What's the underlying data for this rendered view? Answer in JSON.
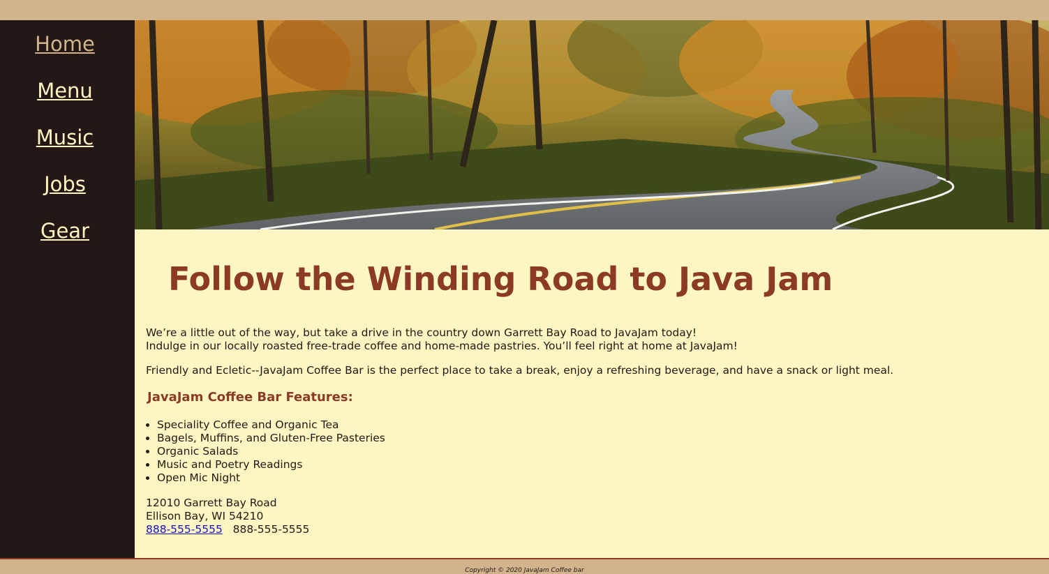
{
  "nav": {
    "items": [
      {
        "label": "Home"
      },
      {
        "label": "Menu"
      },
      {
        "label": "Music"
      },
      {
        "label": "Jobs"
      },
      {
        "label": "Gear"
      }
    ]
  },
  "hero": {
    "image_subject": "winding-road-autumn-forest"
  },
  "main": {
    "headline": "Follow the Winding Road to Java Jam",
    "intro_line1": "We’re a little out of the way, but take a drive in the country down Garrett Bay Road to JavaJam today!",
    "intro_line2": "Indulge in our locally roasted free-trade coffee and home-made pastries. You’ll feel right at home at JavaJam!",
    "paragraph2": "Friendly and Ecletic--JavaJam Coffee Bar is the perfect place to take a break, enjoy a refreshing beverage, and have a snack or light meal.",
    "features_title": "JavaJam Coffee Bar Features:",
    "features": [
      "Speciality Coffee and Organic Tea",
      "Bagels, Muffins, and Gluten-Free Pasteries",
      "Organic Salads",
      "Music and Poetry Readings",
      "Open Mic Night"
    ],
    "address_line1": "12010 Garrett Bay Road",
    "address_line2": "Ellison Bay, WI 54210",
    "phone_link": "888-555-5555",
    "phone_text": "888-555-5555"
  },
  "footer": {
    "copyright": "Copyright © 2020 JavaJam Coffee bar"
  },
  "colors": {
    "sidebar_bg": "#231815",
    "nav_link": "#fef6c2",
    "nav_current": "#d2b48c",
    "main_bg": "#fef6c2",
    "heading": "#8b3a25",
    "frame_bg": "#d2b48c"
  }
}
